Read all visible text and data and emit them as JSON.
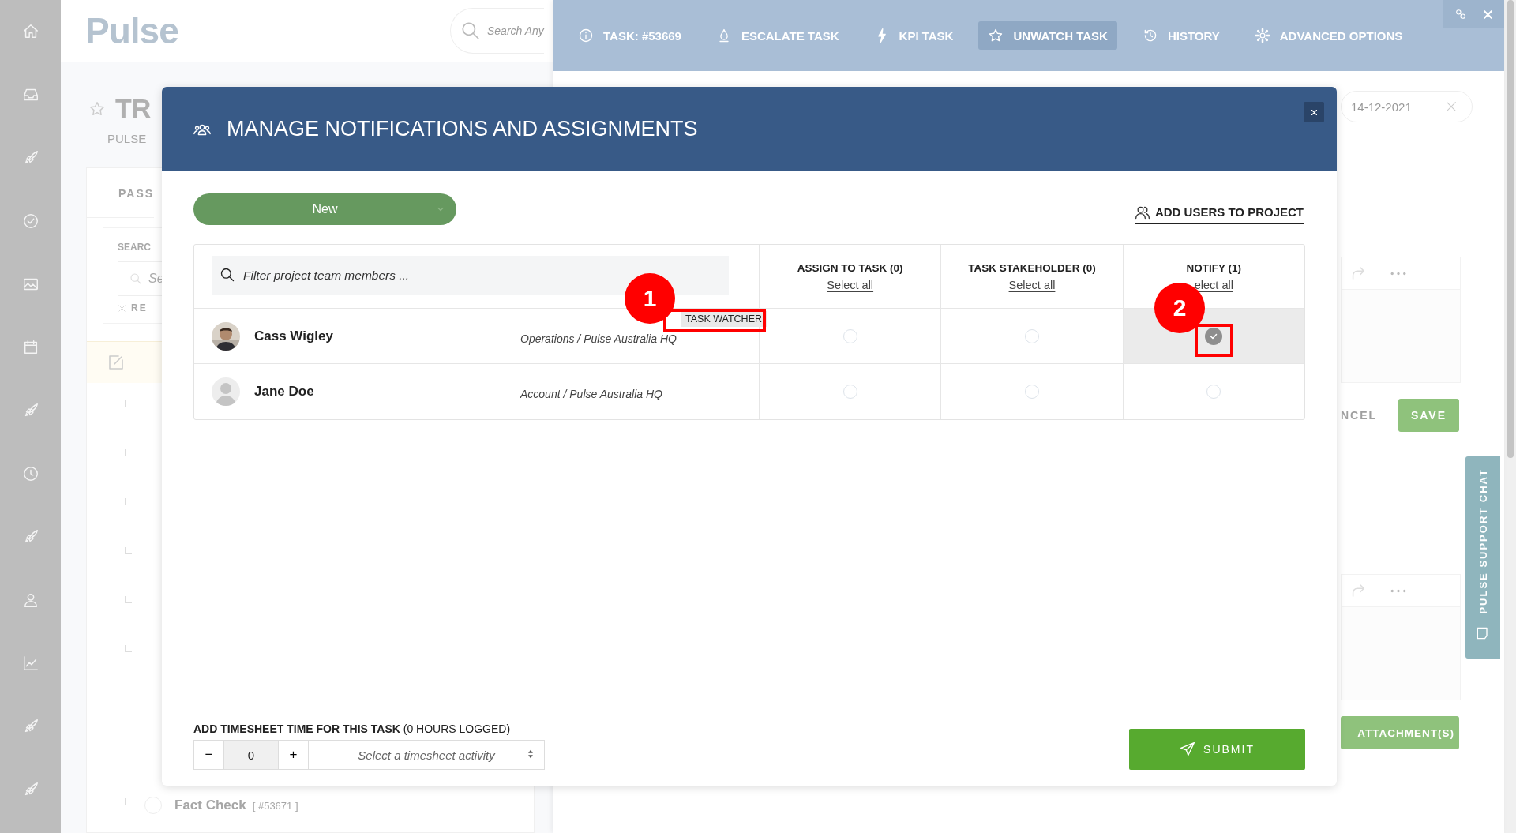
{
  "app_header": {
    "logo": "Pulse",
    "search": {
      "placeholder": "Search Any"
    }
  },
  "background_page": {
    "title": "TR",
    "subtitle": "PULSE",
    "tab": "PASS",
    "search_label": "SEARC",
    "search_placeholder": "Se",
    "reset": "RE",
    "last_task": {
      "name": "Fact Check",
      "id": "[ #53671 ]",
      "checked": false
    }
  },
  "task_panel": {
    "toolbar": [
      {
        "label": "TASK: #53669",
        "selected": false
      },
      {
        "label": "ESCALATE TASK",
        "selected": false
      },
      {
        "label": "KPI TASK",
        "selected": false
      },
      {
        "label": "UNWATCH TASK",
        "selected": true
      },
      {
        "label": "HISTORY",
        "selected": false
      },
      {
        "label": "ADVANCED OPTIONS",
        "selected": false
      }
    ],
    "date": "14-12-2021",
    "cancel": "NCEL",
    "save": "SAVE",
    "attachments": "ATTACHMENT(S)"
  },
  "support_chat": "PULSE SUPPORT CHAT",
  "modal": {
    "title": "MANAGE NOTIFICATIONS AND ASSIGNMENTS",
    "status": "New",
    "add_users": "ADD USERS TO PROJECT",
    "filter_placeholder": "Filter project team members ...",
    "columns": [
      {
        "title": "ASSIGN TO TASK (0)",
        "action": "Select all"
      },
      {
        "title": "TASK STAKEHOLDER (0)",
        "action": "Select all"
      },
      {
        "title": "NOTIFY (1)",
        "action": "elect all"
      }
    ],
    "members": [
      {
        "name": "Cass Wigley",
        "department": "Operations / Pulse Australia HQ",
        "tag": "TASK WATCHER",
        "assign": false,
        "stakeholder": false,
        "notify": true
      },
      {
        "name": "Jane Doe",
        "department": "Account / Pulse Australia HQ",
        "kind": "placeholder",
        "assign": false,
        "stakeholder": false,
        "notify": false
      }
    ],
    "timesheet": {
      "label": "**ADD TIMESHEET TIME FOR THIS TASK** (0 HOURS LOGGED)",
      "decrement": "−",
      "value": "0",
      "increment": "+",
      "activity_placeholder": "Select a timesheet activity"
    },
    "submit": "SUBMIT"
  },
  "annotations": [
    {
      "label": "1"
    },
    {
      "label": "2"
    }
  ]
}
